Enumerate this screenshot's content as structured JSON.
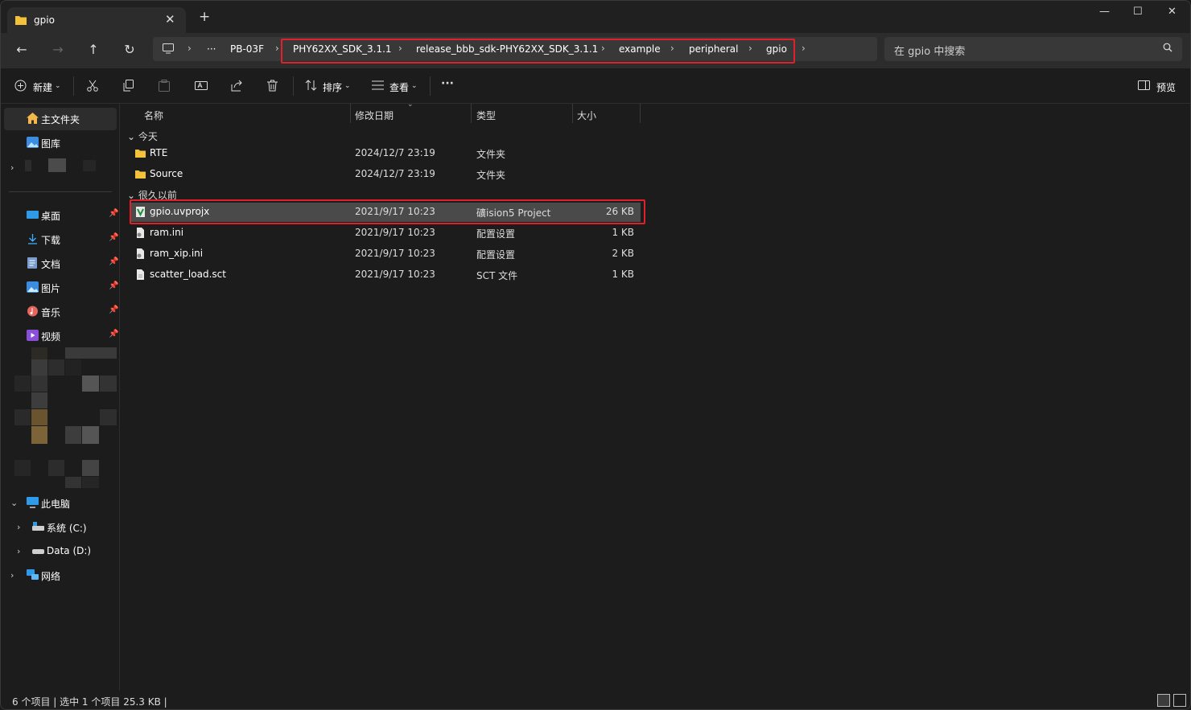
{
  "window": {
    "tab_title": "gpio",
    "close_tab": "✕",
    "new_tab": "+",
    "minimize": "—",
    "maximize": "☐",
    "close": "✕"
  },
  "nav": {
    "back": "←",
    "forward": "→",
    "up": "↑",
    "refresh": "↻"
  },
  "address": {
    "more": "···",
    "crumbs": [
      "PB-03F",
      "PHY62XX_SDK_3.1.1",
      "release_bbb_sdk-PHY62XX_SDK_3.1.1",
      "example",
      "peripheral",
      "gpio"
    ],
    "separator": "›"
  },
  "search": {
    "placeholder": "在 gpio 中搜索"
  },
  "toolbar": {
    "new_label": "新建",
    "sort_label": "排序",
    "view_label": "查看",
    "more": "···",
    "preview_label": "预览"
  },
  "sidebar": {
    "home": "主文件夹",
    "gallery": "图库",
    "quick": [
      {
        "label": "桌面"
      },
      {
        "label": "下载"
      },
      {
        "label": "文档"
      },
      {
        "label": "图片"
      },
      {
        "label": "音乐"
      },
      {
        "label": "视频"
      }
    ],
    "this_pc": "此电脑",
    "drive_c": "系统 (C:)",
    "drive_d": "Data (D:)",
    "network": "网络"
  },
  "columns": {
    "name": "名称",
    "modified": "修改日期",
    "type": "类型",
    "size": "大小"
  },
  "groups": {
    "today": "今天",
    "long_ago": "很久以前"
  },
  "files_today": [
    {
      "name": "RTE",
      "date": "2024/12/7 23:19",
      "type": "文件夹",
      "size": ""
    },
    {
      "name": "Source",
      "date": "2024/12/7 23:19",
      "type": "文件夹",
      "size": ""
    }
  ],
  "files_old": [
    {
      "name": "gpio.uvprojx",
      "date": "2021/9/17 10:23",
      "type": "礦ision5 Project",
      "size": "26 KB"
    },
    {
      "name": "ram.ini",
      "date": "2021/9/17 10:23",
      "type": "配置设置",
      "size": "1 KB"
    },
    {
      "name": "ram_xip.ini",
      "date": "2021/9/17 10:23",
      "type": "配置设置",
      "size": "2 KB"
    },
    {
      "name": "scatter_load.sct",
      "date": "2021/9/17 10:23",
      "type": "SCT 文件",
      "size": "1 KB"
    }
  ],
  "status": {
    "text": "6 个项目  |  选中 1 个项目  25.3 KB  |"
  }
}
